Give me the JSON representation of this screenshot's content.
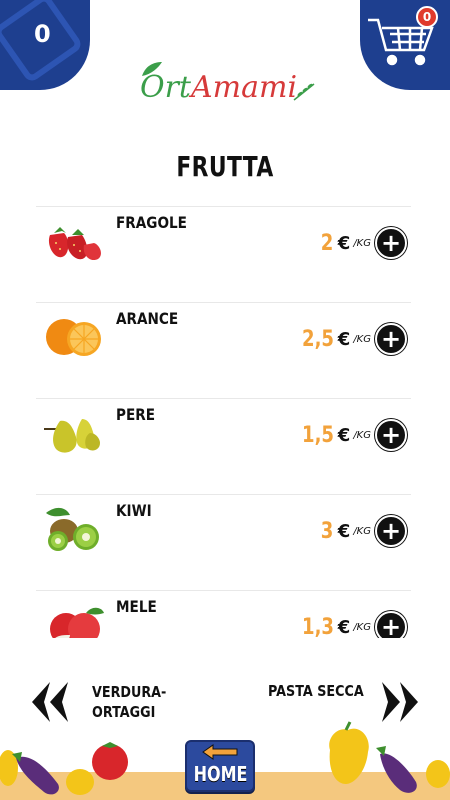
{
  "header": {
    "count_value": "0",
    "cart_badge": "0",
    "logo_part1": "Ort",
    "logo_part2": "Amami"
  },
  "page_title": "FRUTTA",
  "products": [
    {
      "name": "FRAGOLE",
      "price": "2",
      "currency": "€",
      "unit": "/KG",
      "icon": "strawberry-icon"
    },
    {
      "name": "ARANCE",
      "price": "2,5",
      "currency": "€",
      "unit": "/KG",
      "icon": "orange-icon"
    },
    {
      "name": "PERE",
      "price": "1,5",
      "currency": "€",
      "unit": "/KG",
      "icon": "pear-icon"
    },
    {
      "name": "KIWI",
      "price": "3",
      "currency": "€",
      "unit": "/KG",
      "icon": "kiwi-icon"
    },
    {
      "name": "MELE",
      "price": "1,3",
      "currency": "€",
      "unit": "/KG",
      "icon": "apple-icon"
    }
  ],
  "navigation": {
    "prev_label_line1": "VERDURA-",
    "prev_label_line2": "ORTAGGI",
    "next_label": "PASTA SECCA"
  },
  "footer": {
    "home_label": "HOME"
  },
  "colors": {
    "brand_blue": "#1e3f8f",
    "price_orange": "#f2a23b",
    "logo_green": "#3b9e4a",
    "logo_red": "#d63a3a"
  }
}
